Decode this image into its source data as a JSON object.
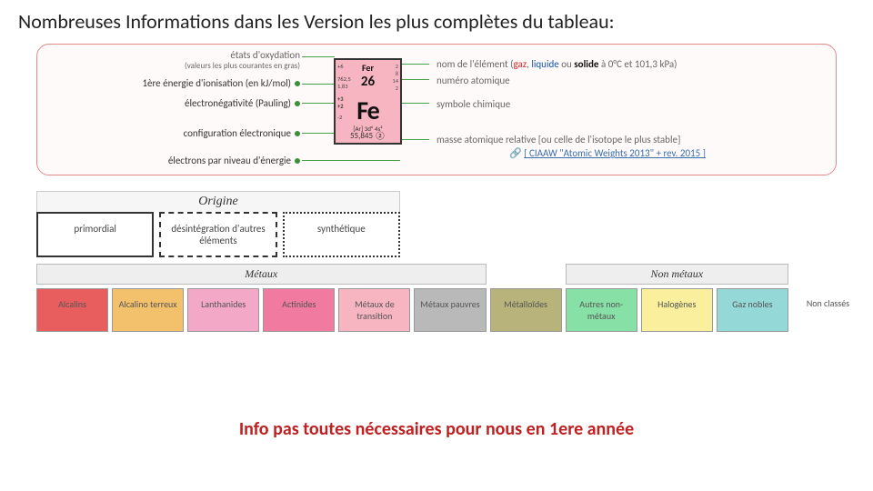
{
  "title": "Nombreuses Informations dans les Version les plus complètes du tableau:",
  "left_labels": {
    "oxidation": "états d'oxydation",
    "oxidation_sub": "(valeurs les plus courantes en gras)",
    "ionization": "1ère énergie d'ionisation (en kJ/mol)",
    "electroneg": "électronégativité (Pauling)",
    "config": "configuration électronique",
    "shells": "électrons par niveau d'énergie"
  },
  "right_labels": {
    "name_prefix": "nom de l'élément (",
    "gas": "gaz",
    "sep1": ", ",
    "liq": "liquide",
    "sep2": " ou ",
    "sol": "solide",
    "name_suffix": " à 0°C et 101,3 kPa)",
    "atomic_num": "numéro atomique",
    "symbol": "symbole chimique",
    "mass": "masse atomique relative [ou celle de l'isotope le plus stable]",
    "ref": "[ CIAAW \"Atomic Weights 2013\" + rev. 2015 ]"
  },
  "tile": {
    "name": "Fer",
    "number": "26",
    "symbol": "Fe",
    "config": "[Ar] 3d⁶ 4s²",
    "mass": "55,845 ②",
    "left_top": "+6",
    "left_ion1": "762,5",
    "left_ion2": "1,83",
    "left_ox1": "+3",
    "left_ox2": "+2",
    "left_bot": "-2",
    "right_sh1": "2",
    "right_sh2": "8",
    "right_sh3": "14",
    "right_sh4": "2"
  },
  "origine": {
    "header": "Origine",
    "primordial": "primordial",
    "decay": "désintégration d'autres éléments",
    "synth": "synthétique"
  },
  "cat_headers": {
    "metals": "Métaux",
    "nonmetals": "Non métaux"
  },
  "categories": [
    {
      "label": "Alcalins",
      "bg": "#e85d5d"
    },
    {
      "label": "Alcalino terreux",
      "bg": "#f3c06b"
    },
    {
      "label": "Lanthanides",
      "bg": "#f4a8c8"
    },
    {
      "label": "Actinides",
      "bg": "#f17aa0"
    },
    {
      "label": "Métaux de transition",
      "bg": "#f7b5c1"
    },
    {
      "label": "Métaux pauvres",
      "bg": "#b9b9b9"
    },
    {
      "label": "Métalloïdes",
      "bg": "#b7b37a"
    },
    {
      "label": "Autres non-métaux",
      "bg": "#87e0a6"
    },
    {
      "label": "Halogènes",
      "bg": "#f9ef9c"
    },
    {
      "label": "Gaz nobles",
      "bg": "#95d8d8"
    },
    {
      "label": "Non classés",
      "bg": "#ffffff"
    }
  ],
  "footer": "Info pas toutes nécessaires pour nous en 1ere année"
}
